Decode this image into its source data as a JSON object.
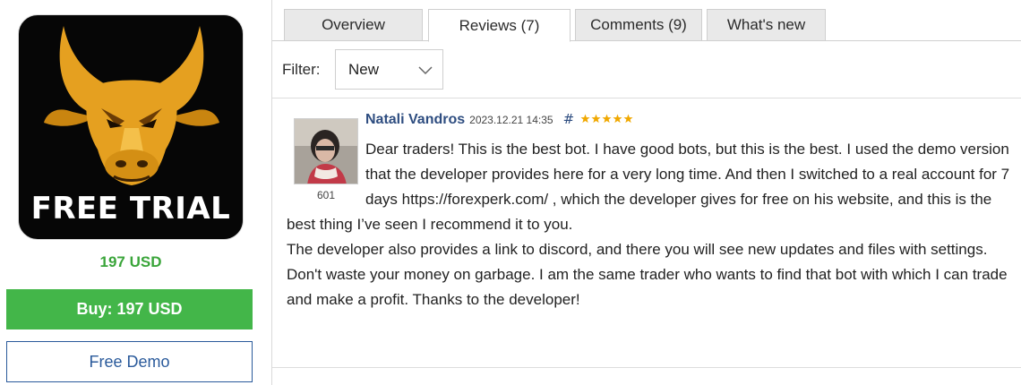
{
  "product": {
    "logo_caption": "FREE TRIAL",
    "price": "197 USD",
    "buy_label": "Buy: 197 USD",
    "demo_label": "Free Demo",
    "logo_colors": {
      "background": "#060606",
      "bull": "#e5a020",
      "caption": "#ffffff"
    }
  },
  "tabs": [
    {
      "label": "Overview",
      "active": false
    },
    {
      "label": "Reviews (7)",
      "active": true
    },
    {
      "label": "Comments (9)",
      "active": false
    },
    {
      "label": "What's new",
      "active": false
    }
  ],
  "filter": {
    "label": "Filter:",
    "selected": "New"
  },
  "review": {
    "author": "Natali Vandros",
    "date": "2023.12.21 14:35",
    "hash": "#",
    "rating": 5,
    "avatar_count": "601",
    "paragraphs": [
      "Dear traders! This is the best bot. I have good bots, but this is the best. I used the demo version that the developer provides here for a very long time. And then I switched to a real account for 7 days https://forexperk.com/ , which the developer gives for free on his website, and this is the best thing I’ve seen I recommend it to you.",
      "The developer also provides a link to discord, and there you will see new updates and files with settings.",
      "Don't waste your money on garbage. I am the same trader who wants to find that bot with which I can trade and make a profit. Thanks to the developer!"
    ]
  },
  "colors": {
    "accent_green": "#43b649",
    "price_green": "#3aa53a",
    "link_blue": "#2e4d80",
    "star": "#f0a800"
  }
}
